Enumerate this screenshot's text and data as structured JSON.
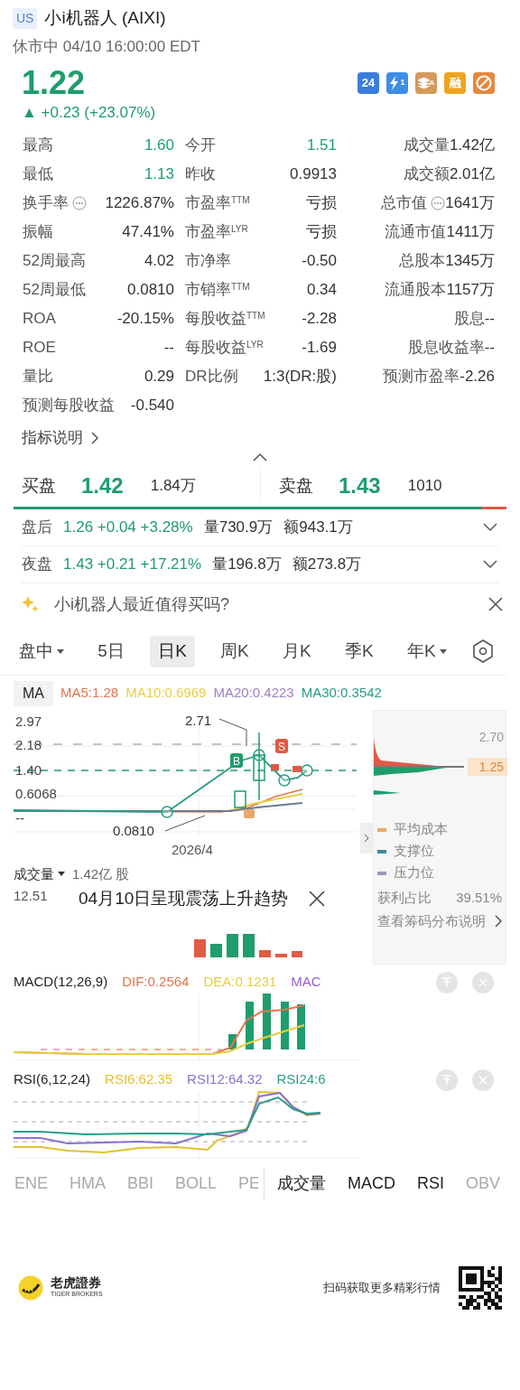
{
  "header": {
    "market_badge": "US",
    "title": "小i机器人 (AIXI)",
    "status": "休市中 04/10 16:00:00 EDT"
  },
  "quote": {
    "price": "1.22",
    "change": "▲ +0.23 (+23.07%)",
    "rising": true
  },
  "feature_icons": [
    {
      "kind": "hours",
      "label": "24"
    },
    {
      "kind": "flash",
      "label": "1"
    },
    {
      "kind": "stack",
      "label": "A"
    },
    {
      "kind": "margin",
      "label": "融"
    },
    {
      "kind": "no-short"
    }
  ],
  "stats": [
    [
      {
        "label": "最高",
        "value": "1.60",
        "highlighted": true
      },
      {
        "label": "今开",
        "value": "1.51",
        "highlighted": true
      },
      {
        "label": "成交量",
        "value": "1.42亿",
        "highlighted": false
      }
    ],
    [
      {
        "label": "最低",
        "value": "1.13",
        "highlighted": true
      },
      {
        "label": "昨收",
        "value": "0.9913",
        "highlighted": false
      },
      {
        "label": "成交额",
        "value": "2.01亿",
        "highlighted": false
      }
    ],
    [
      {
        "label": "换手率",
        "value": "1226.87%",
        "highlighted": false,
        "info": true
      },
      {
        "label": "市盈率$^{TTM}$",
        "value": "亏损",
        "highlighted": false
      },
      {
        "label": "总市值",
        "value": "1641万",
        "highlighted": false,
        "info": true
      }
    ],
    [
      {
        "label": "振幅",
        "value": "47.41%",
        "highlighted": false
      },
      {
        "label": "市盈率$^{LYR}$",
        "value": "亏损",
        "highlighted": false
      },
      {
        "label": "流通市值",
        "value": "1411万",
        "highlighted": false
      }
    ],
    [
      {
        "label": "52周最高",
        "value": "4.02",
        "highlighted": false
      },
      {
        "label": "市净率",
        "value": "-0.50",
        "highlighted": false
      },
      {
        "label": "总股本",
        "value": "1345万",
        "highlighted": false
      }
    ],
    [
      {
        "label": "52周最低",
        "value": "0.0810",
        "highlighted": false
      },
      {
        "label": "市销率$^{TTM}$",
        "value": "0.34",
        "highlighted": false
      },
      {
        "label": "流通股本",
        "value": "1157万",
        "highlighted": false
      }
    ],
    [
      {
        "label": "ROA",
        "value": "-20.15%",
        "highlighted": false
      },
      {
        "label": "每股收益$^{TTM}$",
        "value": "-2.28",
        "highlighted": false
      },
      {
        "label": "股息",
        "value": "--",
        "highlighted": false
      }
    ],
    [
      {
        "label": "ROE",
        "value": "--",
        "highlighted": false
      },
      {
        "label": "每股收益$^{LYR}$",
        "value": "-1.69",
        "highlighted": false
      },
      {
        "label": "股息收益率",
        "value": "--",
        "highlighted": false
      }
    ],
    [
      {
        "label": "量比",
        "value": "0.29",
        "highlighted": false
      },
      {
        "label": "DR比例",
        "value": "1:3(DR:股)",
        "highlighted": false
      },
      {
        "label": "预测市盈率",
        "value": "-2.26",
        "highlighted": false
      }
    ],
    [
      {
        "label": "预测每股收益",
        "value": "-0.540",
        "highlighted": false
      }
    ]
  ],
  "indicator_link": "指标说明",
  "order_book": {
    "bid": {
      "label": "买盘",
      "price": "1.42",
      "size": "1.84万"
    },
    "ask": {
      "label": "卖盘",
      "price": "1.43",
      "size": "1010"
    },
    "level": 0.95
  },
  "sessions": [
    {
      "label": "盘后",
      "price": "1.26",
      "change": "+0.04",
      "pct": "+3.28%",
      "volume_label": "量",
      "volume": "730.9万",
      "amount_label": "额",
      "amount": "943.1万"
    },
    {
      "label": "夜盘",
      "price": "1.43",
      "change": "+0.21",
      "pct": "+17.21%",
      "volume_label": "量",
      "volume": "196.8万",
      "amount_label": "额",
      "amount": "273.8万"
    }
  ],
  "ai_prompt": "小i机器人最近值得买吗?",
  "periods": [
    {
      "label": "盘中",
      "dropdown": true,
      "selected": false
    },
    {
      "label": "5日",
      "dropdown": false,
      "selected": false
    },
    {
      "label": "日K",
      "dropdown": false,
      "selected": true
    },
    {
      "label": "周K",
      "dropdown": false,
      "selected": false
    },
    {
      "label": "月K",
      "dropdown": false,
      "selected": false
    },
    {
      "label": "季K",
      "dropdown": false,
      "selected": false
    },
    {
      "label": "年K",
      "dropdown": true,
      "selected": false
    }
  ],
  "ma": {
    "button": "MA",
    "values": [
      {
        "text": "MA5:1.28",
        "color": "#e0764f"
      },
      {
        "text": "MA10:0.6969",
        "color": "#e6cf45"
      },
      {
        "text": "MA20:0.4223",
        "color": "#9a82c6"
      },
      {
        "text": "MA30:0.3542",
        "color": "#2a9d86"
      }
    ]
  },
  "kline": {
    "y_labels": [
      "2.97",
      "2.18",
      "1.40",
      "0.6068",
      "--"
    ],
    "high_label": "2.71",
    "low_label": "0.0810",
    "x_label": "2026/4",
    "buy_marker": "B",
    "sell_marker": "S"
  },
  "chips": {
    "top_price": "2.70",
    "current_price": "1.25",
    "legend": [
      {
        "label": "平均成本",
        "color": "#f0a860"
      },
      {
        "label": "支撑位",
        "color": "#3f8a99"
      },
      {
        "label": "压力位",
        "color": "#a394bd"
      }
    ],
    "profit_label": "获利占比",
    "profit_value": "39.51%",
    "link": "查看筹码分布说明"
  },
  "volume": {
    "label": "成交量",
    "value": "1.42亿 股",
    "max": "12.51"
  },
  "trend_popup": "04月10日呈现震荡上升趋势",
  "macd": {
    "title": "MACD(12,26,9)",
    "values": [
      {
        "text": "DIF:0.2564",
        "color": "#e0764f"
      },
      {
        "text": "DEA:0.1231",
        "color": "#e6cf45"
      },
      {
        "text": "MAC",
        "color": "#9a5ed8"
      }
    ]
  },
  "rsi": {
    "title": "RSI(6,12,24)",
    "values": [
      {
        "text": "RSI6:62.35",
        "color": "#e0c22e"
      },
      {
        "text": "RSI12:64.32",
        "color": "#8a70d0"
      },
      {
        "text": "RSI24:6",
        "color": "#2a9d86"
      }
    ]
  },
  "main_indicators": [
    {
      "label": "ENE",
      "selected": false
    },
    {
      "label": "HMA",
      "selected": false
    },
    {
      "label": "BBI",
      "selected": false
    },
    {
      "label": "BOLL",
      "selected": false
    },
    {
      "label": "PE",
      "selected": false
    }
  ],
  "sub_indicators": [
    {
      "label": "成交量",
      "selected": true
    },
    {
      "label": "MACD",
      "selected": true
    },
    {
      "label": "RSI",
      "selected": true
    },
    {
      "label": "OBV",
      "selected": false
    }
  ],
  "footer": {
    "brand": "老虎證券",
    "brand_en": "TIGER BROKERS",
    "scan_text": "扫码获取更多精彩行情"
  }
}
